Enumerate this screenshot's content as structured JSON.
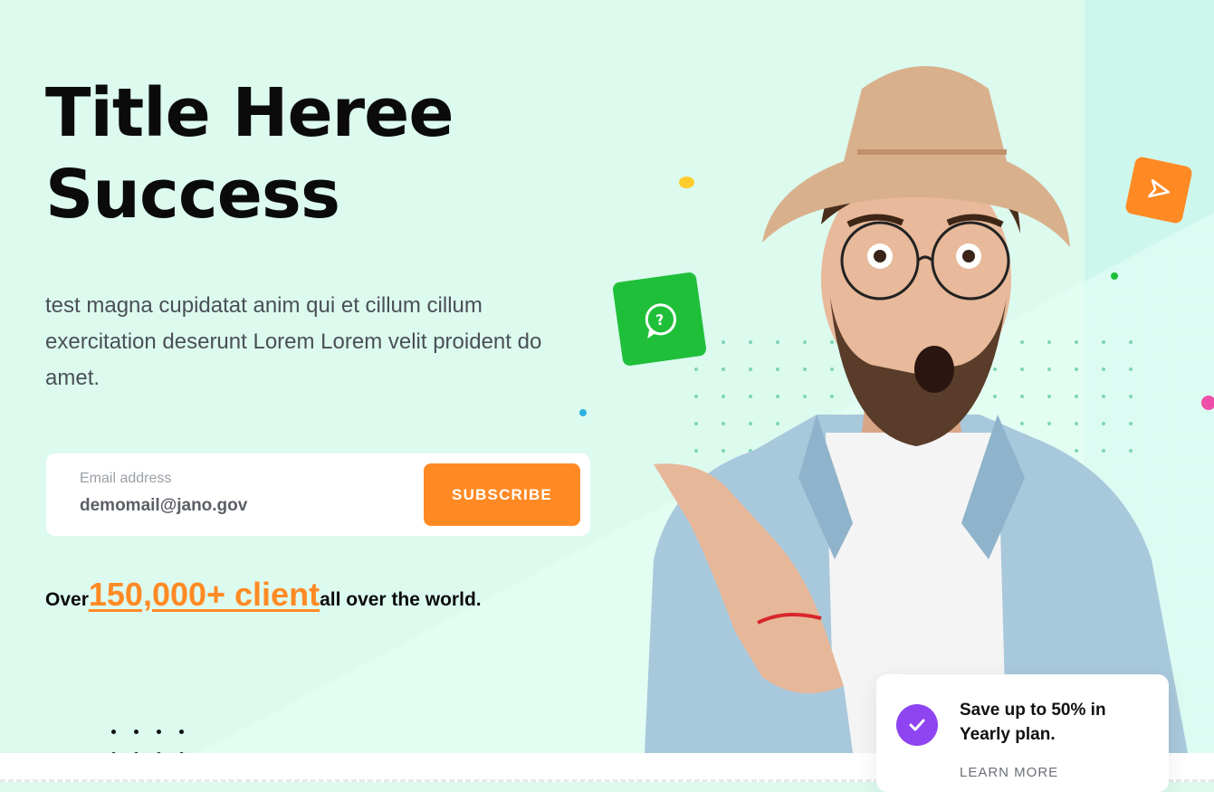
{
  "hero": {
    "title_line1": "Title Heree",
    "title_line2": "Success",
    "description": "test magna cupidatat anim qui et cillum cillum exercitation deserunt Lorem Lorem velit proident do amet."
  },
  "subscribe": {
    "email_label": "Email address",
    "email_value": "demomail@jano.gov",
    "button_label": "SUBSCRIBE"
  },
  "stats": {
    "prefix": "Over",
    "highlight": "150,000+ client",
    "suffix": "all over the world."
  },
  "promo": {
    "text": "Save up to 50% in Yearly plan.",
    "link": "LEARN MORE"
  },
  "colors": {
    "background": "#dcfaee",
    "accent": "#ff8a24",
    "green": "#1fbf3a",
    "purple": "#8e44f0"
  },
  "icons": [
    "help-bubble-icon",
    "send-icon",
    "check-icon"
  ]
}
